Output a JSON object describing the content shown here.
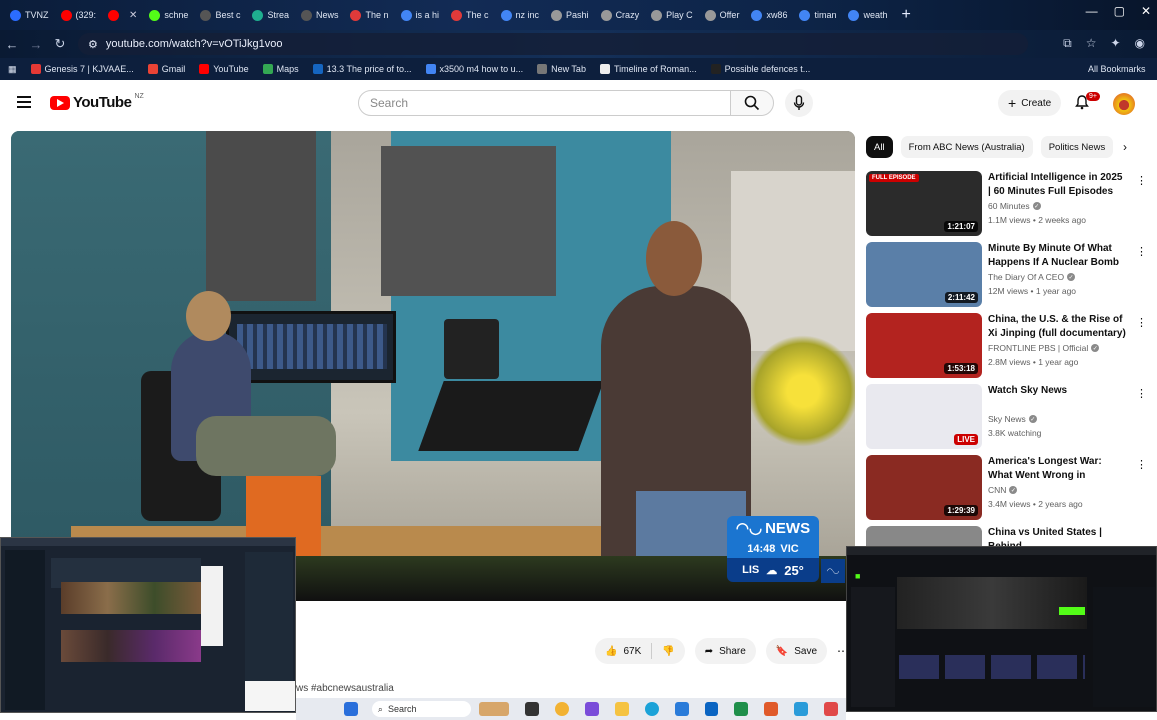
{
  "browser": {
    "tabs": [
      {
        "label": "TVNZ",
        "color": "#2b6cff"
      },
      {
        "label": "(329:",
        "color": "#ff0000"
      },
      {
        "label": "",
        "color": "#ff0000"
      },
      {
        "label": "schne",
        "color": "#53fc18"
      },
      {
        "label": "Best c",
        "color": "#555555"
      },
      {
        "label": "Strea",
        "color": "#1fae8f"
      },
      {
        "label": "News",
        "color": "#555555"
      },
      {
        "label": "The n",
        "color": "#e03a3a"
      },
      {
        "label": "is a hi",
        "color": "#4285f4"
      },
      {
        "label": "The c",
        "color": "#e03a3a"
      },
      {
        "label": "nz inc",
        "color": "#4285f4"
      },
      {
        "label": "Pashi",
        "color": "#999999"
      },
      {
        "label": "Crazy",
        "color": "#999999"
      },
      {
        "label": "Play C",
        "color": "#999999"
      },
      {
        "label": "Offer",
        "color": "#999999"
      },
      {
        "label": "xw86",
        "color": "#4285f4"
      },
      {
        "label": "timan",
        "color": "#4285f4"
      },
      {
        "label": "weath",
        "color": "#4285f4"
      }
    ],
    "url": "youtube.com/watch?v=vOTiJkg1voo",
    "bookmarks": [
      {
        "label": "Genesis 7 | KJVAAE...",
        "color": "#e53935"
      },
      {
        "label": "Gmail",
        "color": "#ea4335"
      },
      {
        "label": "YouTube",
        "color": "#ff0000"
      },
      {
        "label": "Maps",
        "color": "#34a853"
      },
      {
        "label": "13.3 The price of to...",
        "color": "#1565c0"
      },
      {
        "label": "x3500 m4 how to u...",
        "color": "#4285f4"
      },
      {
        "label": "New Tab",
        "color": "#777777"
      },
      {
        "label": "Timeline of Roman...",
        "color": "#eeeeee"
      },
      {
        "label": "Possible defences t...",
        "color": "#222222"
      }
    ],
    "all_bookmarks": "All Bookmarks"
  },
  "youtube": {
    "logo_text": "YouTube",
    "region": "NZ",
    "search_placeholder": "Search",
    "create_label": "Create",
    "notif_badge": "9+",
    "likes": "67K",
    "share": "Share",
    "save": "Save",
    "hashtag": "ws #abcnewsaustralia",
    "chips": [
      "All",
      "From ABC News (Australia)",
      "Politics News"
    ],
    "abc": {
      "brand": "NEWS",
      "time": "14:48",
      "state": "VIC",
      "loc": "LIS",
      "temp": "25°"
    },
    "recs": [
      {
        "title": "Artificial Intelligence in 2025 | 60 Minutes Full Episodes",
        "channel": "60 Minutes",
        "meta": "1.1M views • 2 weeks ago",
        "duration": "1:21:07",
        "badge": "FULL EPISODE",
        "thumb": "#2b2b2b"
      },
      {
        "title": "Minute By Minute Of What Happens If A Nuclear Bomb ...",
        "channel": "The Diary Of A CEO",
        "meta": "12M views • 1 year ago",
        "duration": "2:11:42",
        "badge": "",
        "thumb": "#5a7fa8"
      },
      {
        "title": "China, the U.S. & the Rise of Xi Jinping (full documentary) | ...",
        "channel": "FRONTLINE PBS | Official",
        "meta": "2.8M views • 1 year ago",
        "duration": "1:53:18",
        "badge": "",
        "thumb": "#b3231f"
      },
      {
        "title": "Watch Sky News",
        "channel": "Sky News",
        "meta": "3.8K watching",
        "duration": "LIVE",
        "badge": "",
        "thumb": "#e9e9ef"
      },
      {
        "title": "America's Longest War: What Went Wrong in Afghanistan ...",
        "channel": "CNN",
        "meta": "3.4M views • 2 years ago",
        "duration": "1:29:39",
        "badge": "",
        "thumb": "#8a2a22"
      },
      {
        "title": "China vs United States | Behind",
        "channel": "",
        "meta": "",
        "duration": "",
        "badge": "",
        "thumb": "#888888"
      }
    ]
  },
  "taskbar": {
    "search": "Search"
  }
}
